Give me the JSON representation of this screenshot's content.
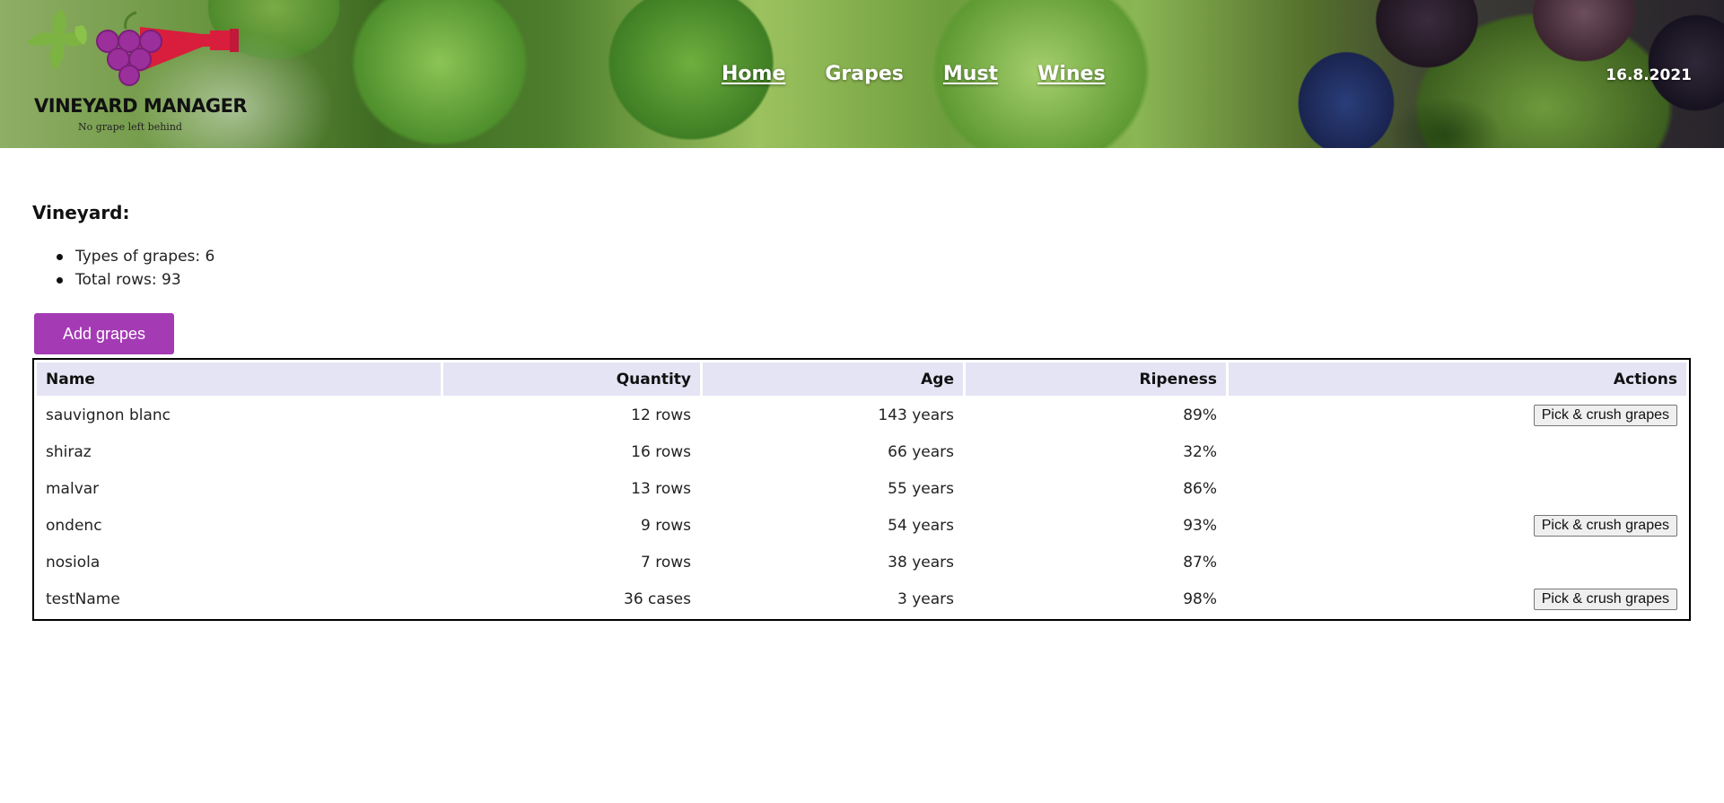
{
  "header": {
    "logo_title": "VINEYARD MANAGER",
    "logo_subtitle": "No grape left behind",
    "nav": [
      {
        "label": "Home"
      },
      {
        "label": "Grapes"
      },
      {
        "label": "Must"
      },
      {
        "label": "Wines"
      }
    ],
    "current_nav": "Grapes",
    "date": "16.8.2021"
  },
  "vineyard": {
    "title": "Vineyard:",
    "stats": [
      "Types of grapes: 6",
      "Total rows: 93"
    ],
    "add_button": "Add grapes"
  },
  "table": {
    "headers": {
      "name": "Name",
      "quantity": "Quantity",
      "age": "Age",
      "ripeness": "Ripeness",
      "actions": "Actions"
    },
    "action_label": "Pick & crush grapes",
    "rows": [
      {
        "name": "sauvignon blanc",
        "quantity": "12 rows",
        "age": "143 years",
        "ripeness": "89%",
        "action": "Pick & crush grapes"
      },
      {
        "name": "shiraz",
        "quantity": "16 rows",
        "age": "66 years",
        "ripeness": "32%",
        "action": ""
      },
      {
        "name": "malvar",
        "quantity": "13 rows",
        "age": "55 years",
        "ripeness": "86%",
        "action": ""
      },
      {
        "name": "ondenc",
        "quantity": "9 rows",
        "age": "54 years",
        "ripeness": "93%",
        "action": "Pick & crush grapes"
      },
      {
        "name": "nosiola",
        "quantity": "7 rows",
        "age": "38 years",
        "ripeness": "87%",
        "action": ""
      },
      {
        "name": "testName",
        "quantity": "36 cases",
        "age": "3 years",
        "ripeness": "98%",
        "action": "Pick & crush grapes"
      }
    ]
  },
  "colors": {
    "accent": "#a43ab4",
    "table_header_bg": "#e4e4f5",
    "logo_bottle": "#d81e3c",
    "logo_grapes": "#9b2f9b",
    "logo_leaves": "#7cb342"
  },
  "icons": {
    "logo": "grape-bottle-logo"
  }
}
